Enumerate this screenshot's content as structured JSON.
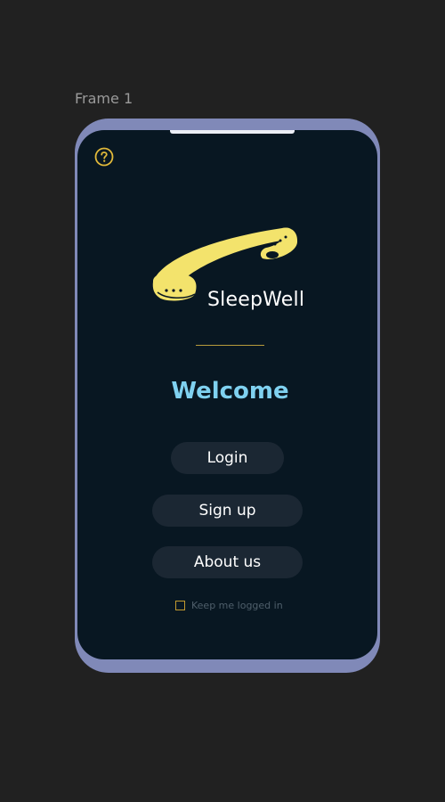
{
  "canvas": {
    "frame_label": "Frame 1"
  },
  "app": {
    "brand": "SleepWell",
    "welcome": "Welcome",
    "buttons": {
      "login": "Login",
      "signup": "Sign up",
      "about": "About us"
    },
    "keep_logged_in": {
      "label": "Keep me logged in",
      "checked": false
    }
  },
  "colors": {
    "background": "#212121",
    "phone_frame": "#8089b8",
    "screen": "#081722",
    "accent_yellow": "#f3e36c",
    "welcome_text": "#7fd1f0",
    "button_bg": "#1b2733",
    "divider": "#b89b3c"
  },
  "icons": {
    "help": "help-circle-icon",
    "logo": "sleep-band-logo-icon"
  }
}
